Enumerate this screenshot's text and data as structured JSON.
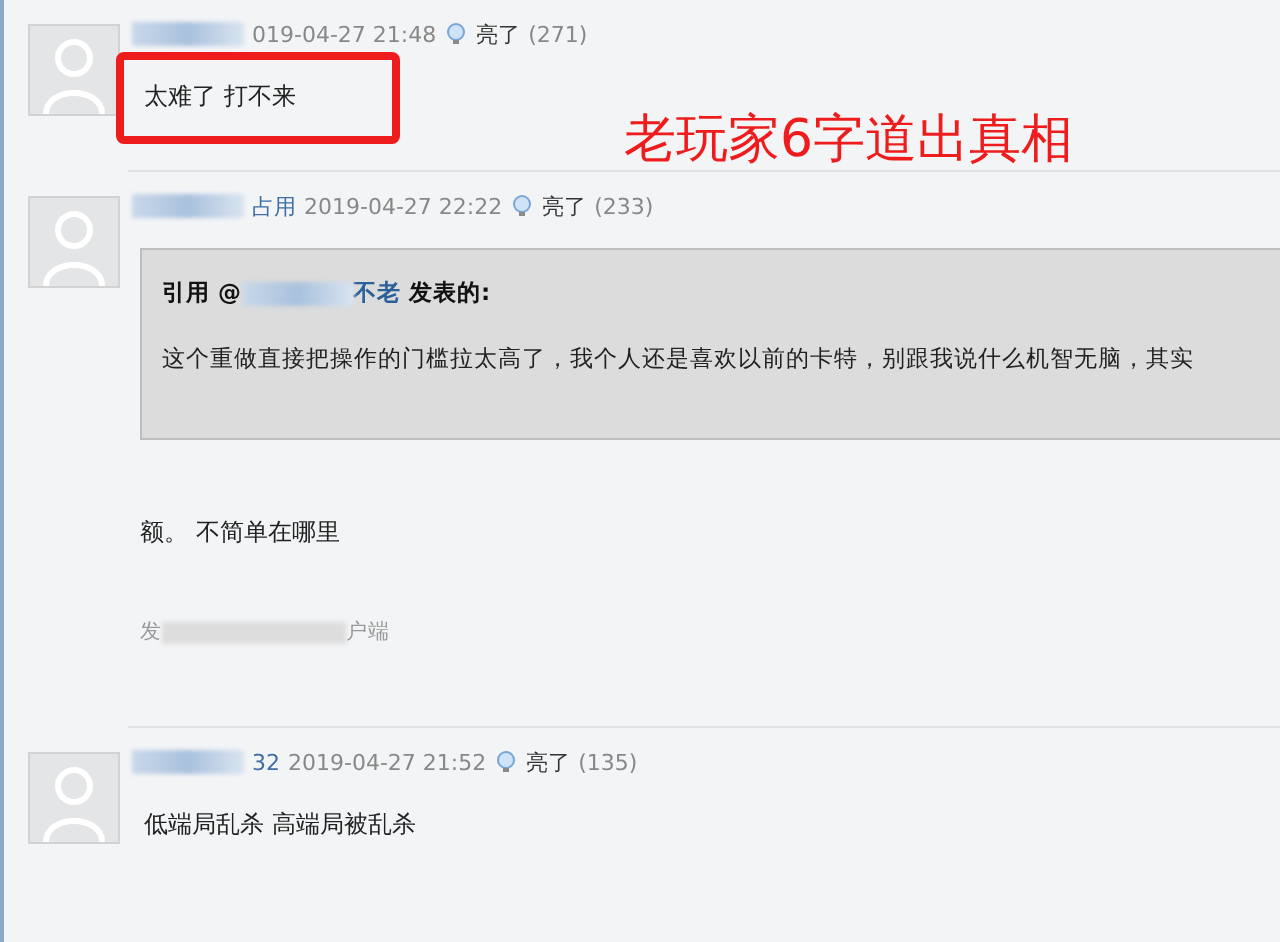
{
  "annotation": {
    "text": "老玩家6字道出真相"
  },
  "posts": [
    {
      "time": "019-04-27 21:48",
      "like_label": "亮了",
      "like_count": "(271)",
      "highlighted": true,
      "content": "太难了 打不来"
    },
    {
      "author_suffix": "占用",
      "time": "2019-04-27 22:22",
      "like_label": "亮了",
      "like_count": "(233)",
      "highlighted": false,
      "quote": {
        "lead": "引用 @",
        "name_suffix": "不老",
        "tail": "发表的:",
        "text": "这个重做直接把操作的门槛拉太高了，我个人还是喜欢以前的卡特，别跟我说什么机智无脑，其实"
      },
      "content": "额。 不简单在哪里",
      "source_prefix": "发",
      "source_suffix": "户端"
    },
    {
      "author_suffix": "32",
      "time": "2019-04-27 21:52",
      "like_label": "亮了",
      "like_count": "(135)",
      "highlighted": false,
      "content": "低端局乱杀 高端局被乱杀"
    }
  ]
}
